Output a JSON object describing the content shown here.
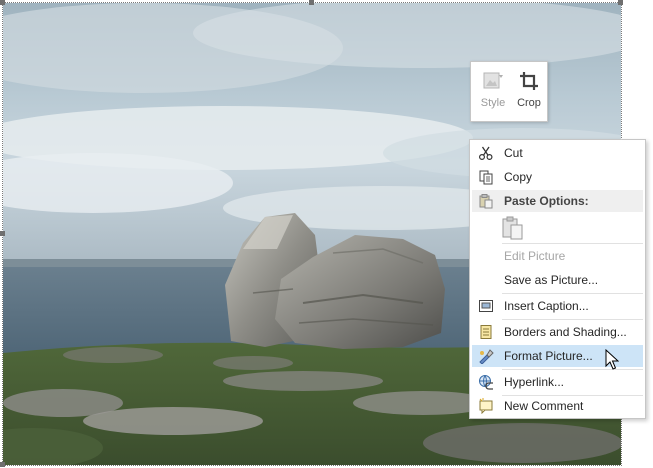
{
  "mini_toolbar": {
    "style_label": "Style",
    "crop_label": "Crop"
  },
  "context_menu": {
    "items": [
      {
        "label": "Cut",
        "icon": "scissors-icon",
        "enabled": true
      },
      {
        "label": "Copy",
        "icon": "copy-icon",
        "enabled": true
      },
      {
        "label": "Paste Options:",
        "icon": "paste-icon",
        "enabled": false
      },
      {
        "label": "Edit Picture",
        "icon": "",
        "enabled": false
      },
      {
        "label": "Save as Picture...",
        "icon": "",
        "enabled": true
      },
      {
        "label": "Insert Caption...",
        "icon": "caption-icon",
        "enabled": true
      },
      {
        "label": "Borders and Shading...",
        "icon": "borders-icon",
        "enabled": true
      },
      {
        "label": "Format Picture...",
        "icon": "format-picture-icon",
        "enabled": true,
        "highlighted": true
      },
      {
        "label": "Hyperlink...",
        "icon": "hyperlink-icon",
        "enabled": true
      },
      {
        "label": "New Comment",
        "icon": "new-comment-icon",
        "enabled": true
      }
    ]
  },
  "colors": {
    "menu_highlight": "#cde4f7",
    "section_header_bg": "#efefef",
    "disabled_text": "#a6a6a6"
  }
}
